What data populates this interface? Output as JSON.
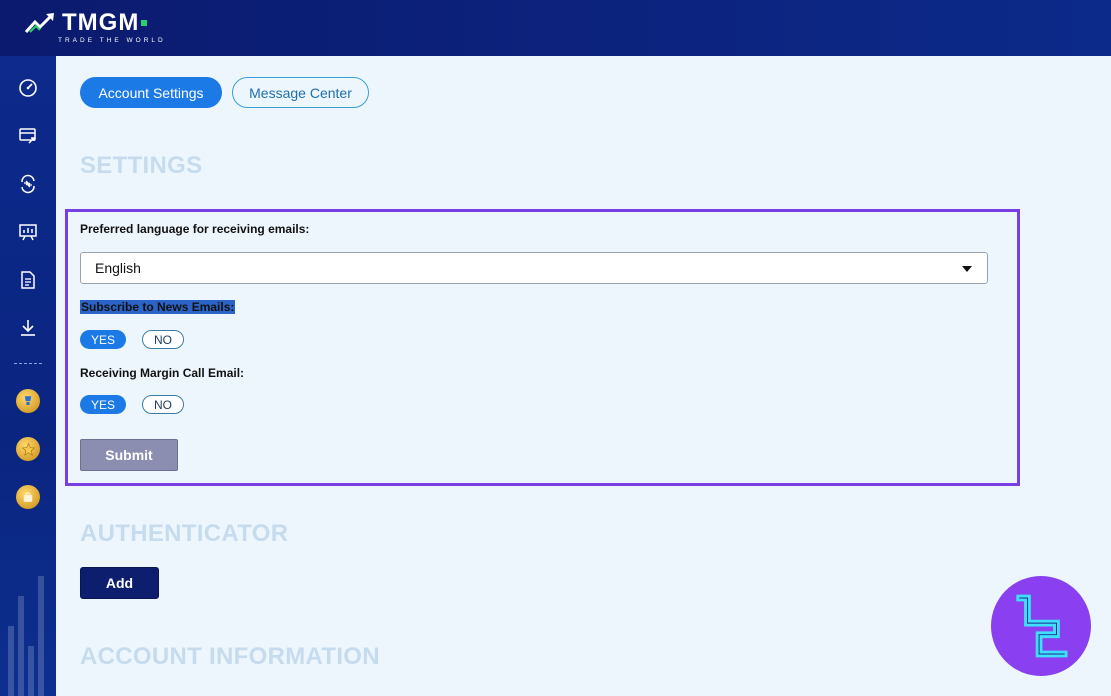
{
  "brand": {
    "name": "TMGM",
    "tagline": "TRADE THE WORLD",
    "accent": "#22d36b"
  },
  "sidebar": {
    "items": [
      {
        "icon": "dashboard-gauge-icon"
      },
      {
        "icon": "deposit-card-icon"
      },
      {
        "icon": "transfer-arrows-icon"
      },
      {
        "icon": "trading-board-icon"
      },
      {
        "icon": "document-icon"
      },
      {
        "icon": "download-icon"
      }
    ],
    "badges": [
      {
        "icon": "trophy-badge-icon"
      },
      {
        "icon": "star-badge-icon"
      },
      {
        "icon": "shopping-bag-badge-icon"
      }
    ]
  },
  "tabs": [
    {
      "label": "Account Settings",
      "active": true
    },
    {
      "label": "Message Center",
      "active": false
    }
  ],
  "settings": {
    "title": "SETTINGS",
    "language_label": "Preferred language for receiving emails:",
    "language_value": "English",
    "news_label": "Subscribe to News Emails:",
    "news_yes": "YES",
    "news_no": "NO",
    "margin_label": "Receiving Margin Call Email:",
    "margin_yes": "YES",
    "margin_no": "NO",
    "submit_label": "Submit"
  },
  "authenticator": {
    "title": "AUTHENTICATOR",
    "add_label": "Add"
  },
  "account_info": {
    "title": "ACCOUNT INFORMATION"
  },
  "colors": {
    "primary": "#1b7ae6",
    "navy": "#0d2a8c",
    "highlight": "#7a3fe4",
    "watermark": "#8a3ff0"
  }
}
